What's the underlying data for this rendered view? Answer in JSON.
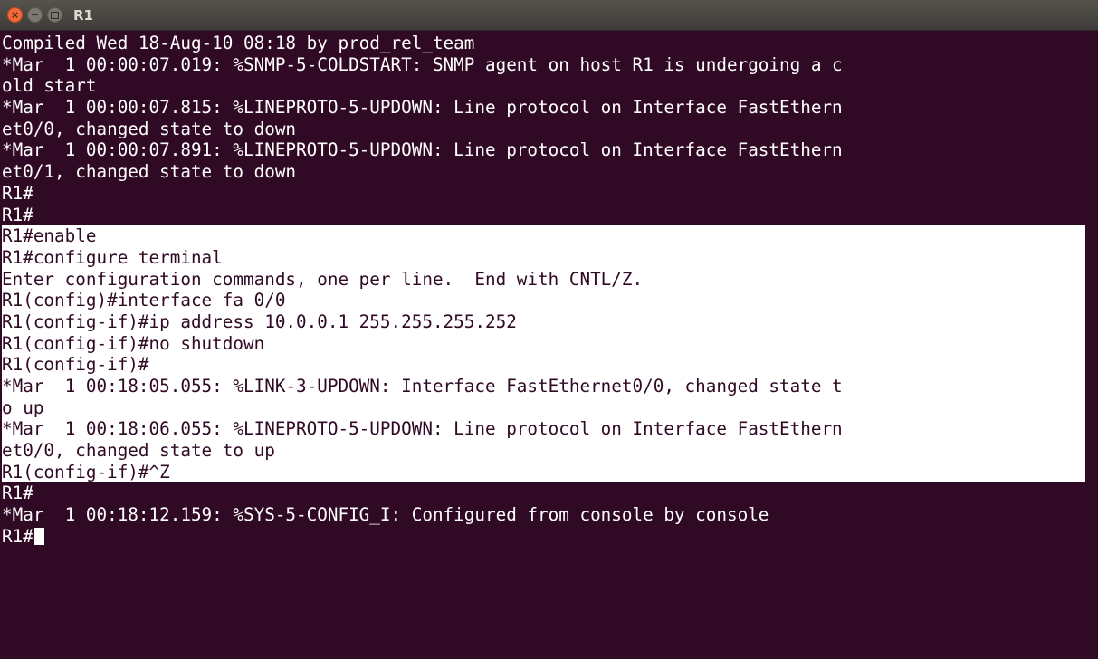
{
  "window": {
    "title": "R1",
    "colors": {
      "terminal_background": "#300a24",
      "terminal_text": "#ffffff",
      "highlight_background": "#ffffff",
      "highlight_text": "#300a24",
      "close_button": "#ef6a3a"
    },
    "controls": {
      "close_glyph": "×",
      "minimize_glyph": "−"
    }
  },
  "terminal": {
    "before_selection": [
      "Compiled Wed 18-Aug-10 08:18 by prod_rel_team",
      "*Mar  1 00:00:07.019: %SNMP-5-COLDSTART: SNMP agent on host R1 is undergoing a c",
      "old start",
      "*Mar  1 00:00:07.815: %LINEPROTO-5-UPDOWN: Line protocol on Interface FastEthern",
      "et0/0, changed state to down",
      "*Mar  1 00:00:07.891: %LINEPROTO-5-UPDOWN: Line protocol on Interface FastEthern",
      "et0/1, changed state to down",
      "R1#",
      "R1#"
    ],
    "selection": [
      "R1#enable",
      "R1#configure terminal",
      "Enter configuration commands, one per line.  End with CNTL/Z.",
      "R1(config)#interface fa 0/0",
      "R1(config-if)#ip address 10.0.0.1 255.255.255.252",
      "R1(config-if)#no shutdown",
      "R1(config-if)#",
      "*Mar  1 00:18:05.055: %LINK-3-UPDOWN: Interface FastEthernet0/0, changed state t",
      "o up",
      "*Mar  1 00:18:06.055: %LINEPROTO-5-UPDOWN: Line protocol on Interface FastEthern",
      "et0/0, changed state to up",
      "R1(config-if)#^Z"
    ],
    "after_selection": [
      "R1#",
      "*Mar  1 00:18:12.159: %SYS-5-CONFIG_I: Configured from console by console"
    ],
    "prompt": "R1#"
  }
}
